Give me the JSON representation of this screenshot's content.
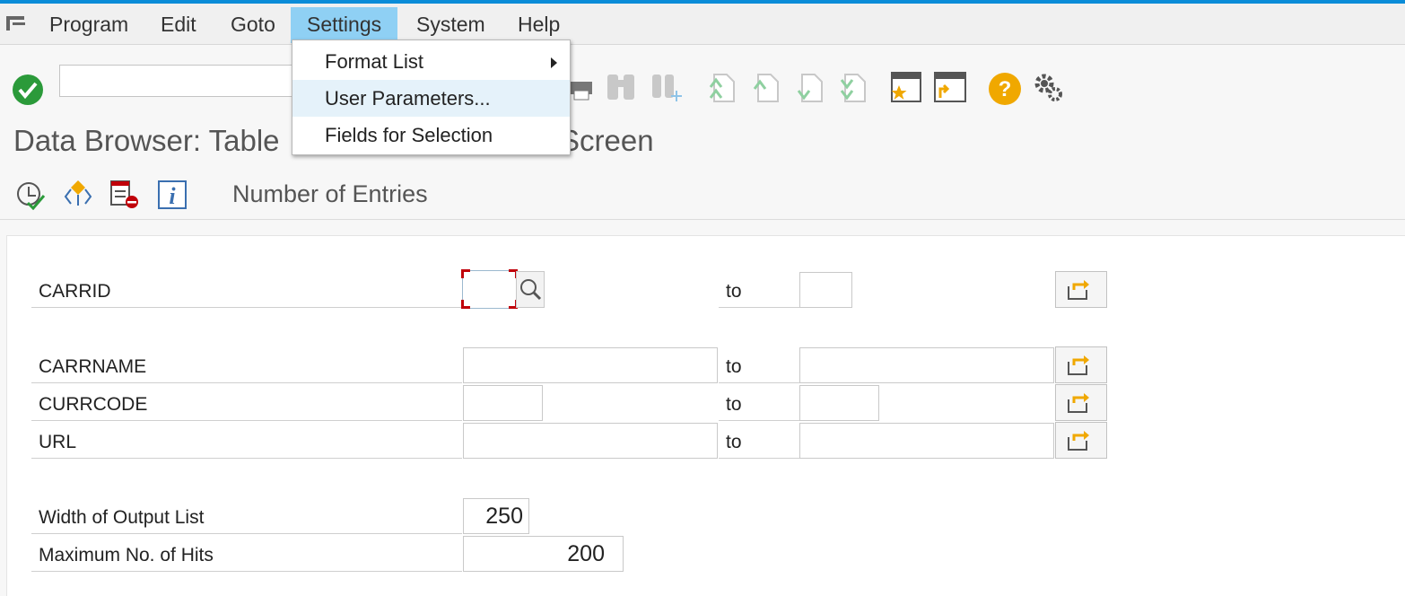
{
  "menubar": {
    "items": [
      "Program",
      "Edit",
      "Goto",
      "Settings",
      "System",
      "Help"
    ],
    "active": "Settings"
  },
  "settings_menu": {
    "items": [
      {
        "label": "Format List",
        "has_submenu": true
      },
      {
        "label": "User Parameters...",
        "has_submenu": false
      },
      {
        "label": "Fields for Selection",
        "has_submenu": false
      }
    ]
  },
  "toolbar": {
    "command_field": "",
    "icons": [
      "enter-icon",
      "save-icon",
      "back-icon",
      "exit-icon",
      "cancel-icon",
      "print-icon",
      "find-icon",
      "find-next-icon",
      "first-page-icon",
      "previous-page-icon",
      "next-page-icon",
      "last-page-icon",
      "create-shortcut-icon",
      "layout-menu-icon",
      "help-icon",
      "customize-icon"
    ]
  },
  "title": "Data Browser: Table SCARR: Selection Screen",
  "title_visible_left": "Data Browser: Table",
  "title_visible_right": "Screen",
  "appbar": {
    "entries_label": "Number of Entries"
  },
  "selection": {
    "to_label": "to",
    "rows": [
      {
        "label": "CARRID",
        "from": "",
        "to": ""
      },
      {
        "label": "CARRNAME",
        "from": "",
        "to": ""
      },
      {
        "label": "CURRCODE",
        "from": "",
        "to": ""
      },
      {
        "label": "URL",
        "from": "",
        "to": ""
      }
    ],
    "width_label": "Width of Output List",
    "width_value": "250",
    "max_hits_label": "Maximum No. of Hits",
    "max_hits_value": "200"
  },
  "colors": {
    "accent": "#0a8cd8",
    "active_menu": "#8fd0f4",
    "help_icon": "#f0a800",
    "enter_icon": "#2b9a3a",
    "focus_corner": "#c0000a"
  }
}
